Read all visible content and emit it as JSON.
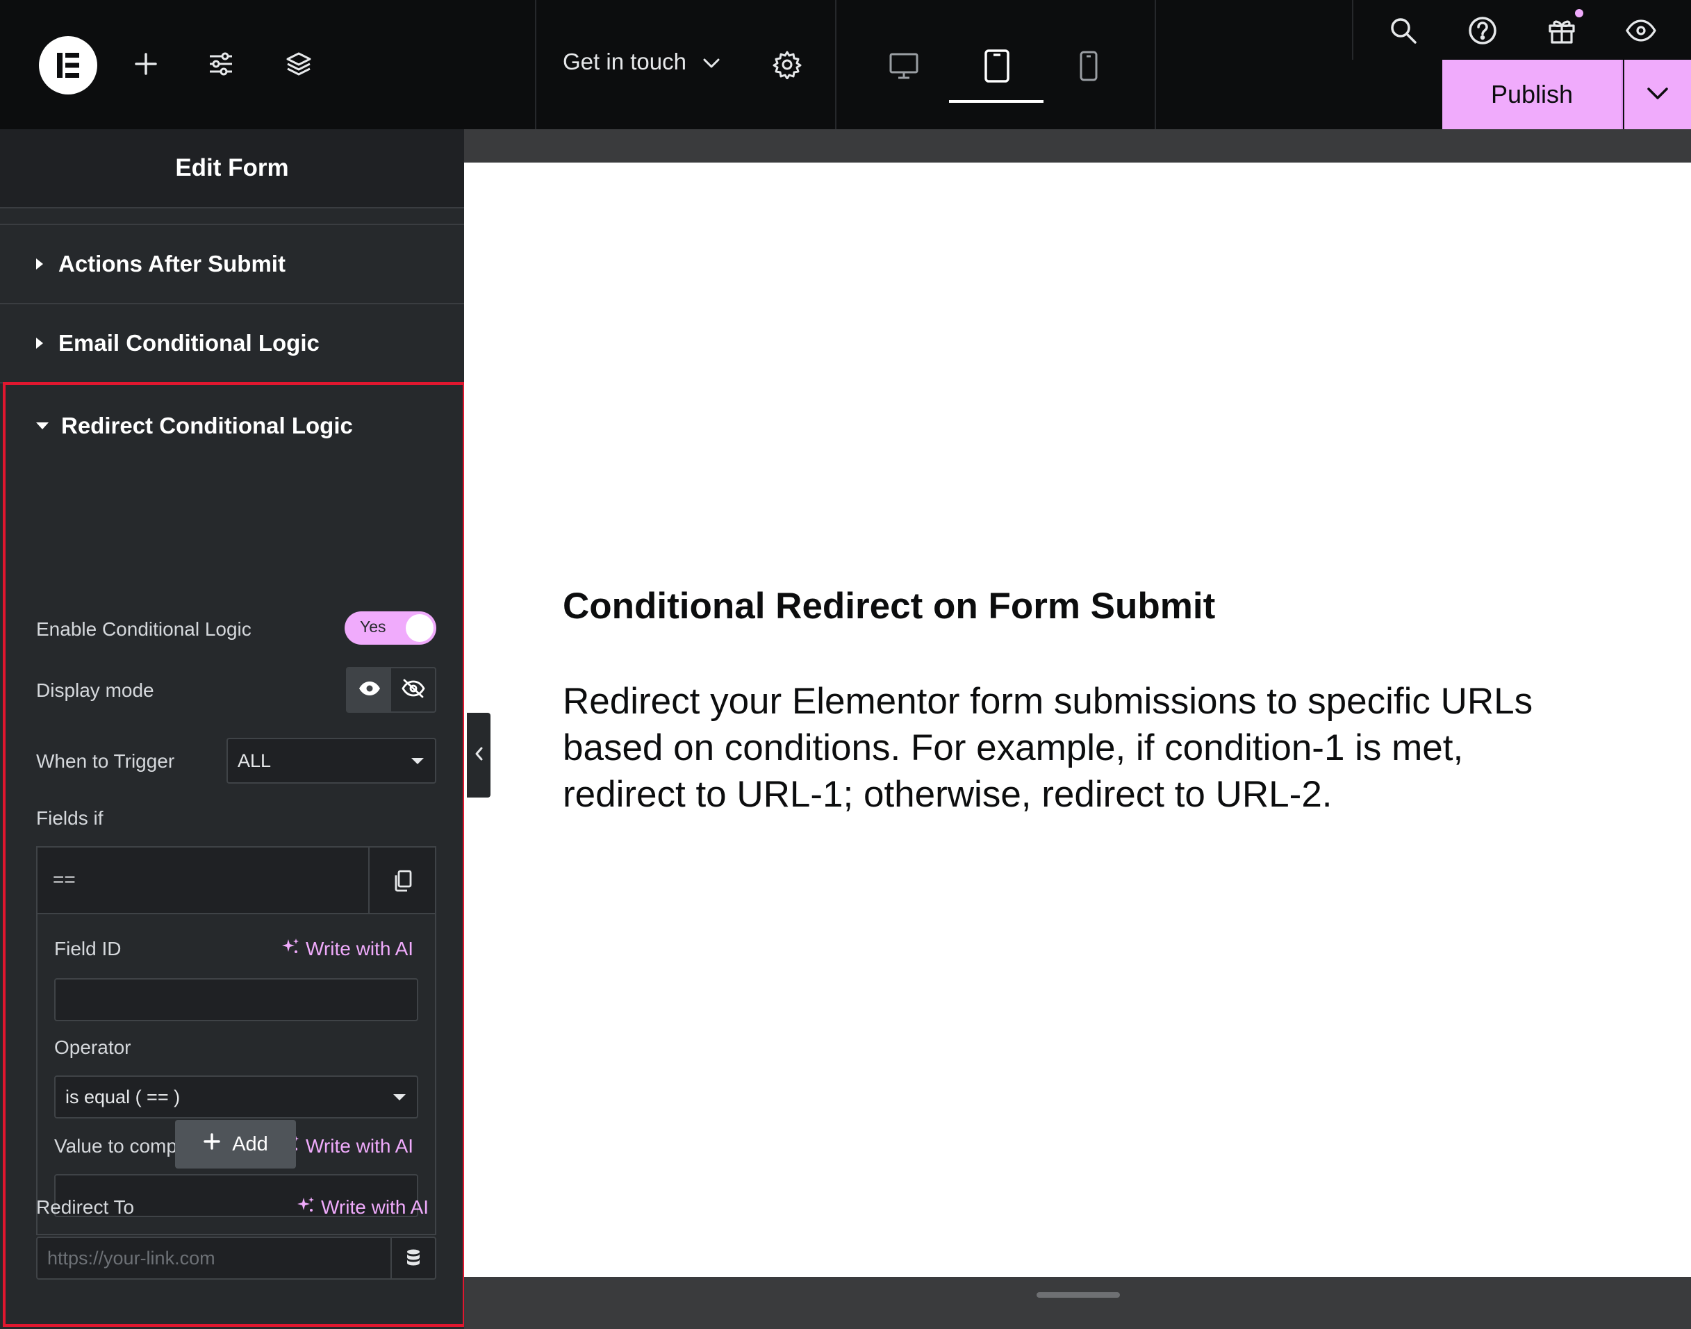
{
  "topbar": {
    "page_name": "Get in touch",
    "publish_label": "Publish",
    "icons": [
      "elementor-logo-icon",
      "plus-icon",
      "sliders-icon",
      "layers-icon",
      "chevron-down-icon",
      "gear-icon",
      "desktop-icon",
      "tablet-icon",
      "mobile-icon",
      "search-icon",
      "help-icon",
      "gift-icon",
      "eye-icon"
    ],
    "accent_color": "#f0abfc"
  },
  "panel": {
    "title": "Edit Form",
    "sections": [
      {
        "label": "Actions After Submit"
      },
      {
        "label": "Email Conditional Logic"
      }
    ],
    "redirect": {
      "title": "Redirect Conditional Logic",
      "enable_label": "Enable Conditional Logic",
      "enable_value": "Yes",
      "display_mode_label": "Display mode",
      "trigger_label": "When to Trigger",
      "trigger_value": "ALL",
      "fields_if_label": "Fields if",
      "repeater_item_title": "==",
      "field_id_label": "Field ID",
      "write_ai": "Write with AI",
      "operator_label": "Operator",
      "operator_value": "is equal ( == )",
      "value_label": "Value to compare",
      "add_label": "Add",
      "redirect_to_label": "Redirect To",
      "redirect_placeholder": "https://your-link.com"
    },
    "highlight_color": "#e0172f"
  },
  "canvas": {
    "title": "Conditional Redirect on Form Submit",
    "body": "Redirect your Elementor form submissions to specific URLs based on conditions. For example, if condition-1 is met, redirect to URL-1; otherwise, redirect to URL-2."
  }
}
